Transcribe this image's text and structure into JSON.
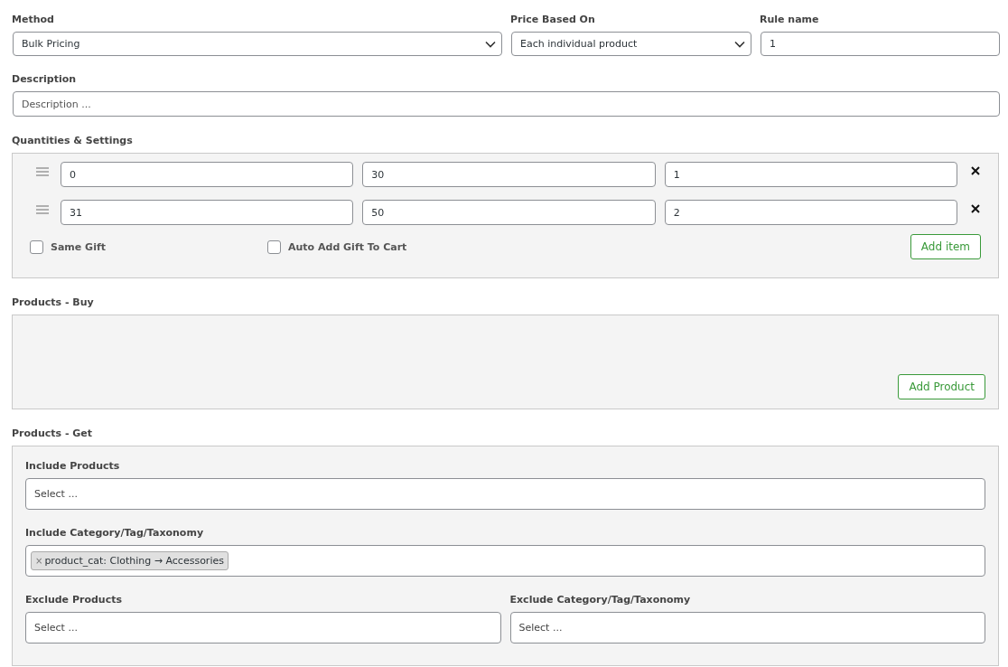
{
  "top_fields": [
    {
      "kind": "select",
      "label": "Method",
      "value": "Bulk Pricing"
    },
    {
      "kind": "select",
      "label": "Price Based On",
      "value": "Each individual product"
    },
    {
      "kind": "text",
      "label": "Rule name",
      "value": "1"
    }
  ],
  "description": {
    "label": "Description",
    "placeholder": "Description ..."
  },
  "quantities": {
    "label": "Quantities & Settings",
    "rows": [
      {
        "values": [
          "0",
          "30",
          "1"
        ]
      },
      {
        "values": [
          "31",
          "50",
          "2"
        ]
      }
    ],
    "checkboxes": [
      {
        "label": "Same Gift",
        "checked": false
      },
      {
        "label": "Auto Add Gift To Cart",
        "checked": false
      }
    ],
    "button": "Add item"
  },
  "products_buy": {
    "label": "Products - Buy",
    "button": "Add Product"
  },
  "products_get": {
    "label": "Products - Get",
    "include_products": {
      "label": "Include Products",
      "placeholder": "Select ..."
    },
    "include_category": {
      "label": "Include Category/Tag/Taxonomy",
      "tags": [
        {
          "remove": "×",
          "text": "product_cat: Clothing → Accessories"
        }
      ]
    },
    "exclude": [
      {
        "label": "Exclude Products",
        "placeholder": "Select ..."
      },
      {
        "label": "Exclude Category/Tag/Taxonomy",
        "placeholder": "Select ..."
      }
    ]
  }
}
